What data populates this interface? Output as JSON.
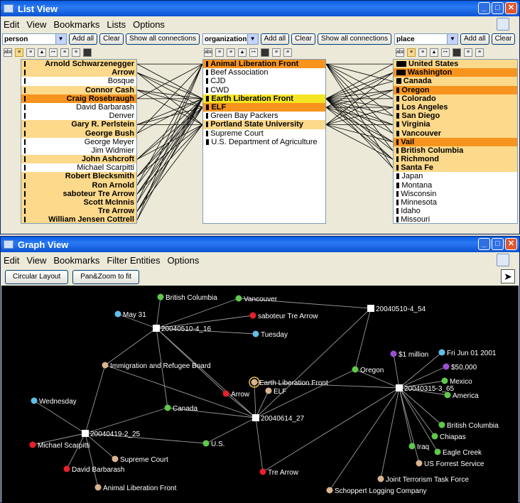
{
  "list_view": {
    "title": "List View",
    "menu": [
      "Edit",
      "View",
      "Bookmarks",
      "Lists",
      "Options"
    ],
    "columns": {
      "person": {
        "selector": "person",
        "add_all": "Add all",
        "clear": "Clear",
        "show_all": "Show all connections",
        "items": [
          {
            "label": "Arnold Schwarzenegger",
            "hl": "light"
          },
          {
            "label": "Arrow",
            "hl": "light"
          },
          {
            "label": "Bosque",
            "hl": "none"
          },
          {
            "label": "Connor Cash",
            "hl": "light"
          },
          {
            "label": "Craig Rosebraugh",
            "hl": "dark"
          },
          {
            "label": "David Barbarash",
            "hl": "none"
          },
          {
            "label": "Denver",
            "hl": "none"
          },
          {
            "label": "Gary R. Perlstein",
            "hl": "light"
          },
          {
            "label": "George Bush",
            "hl": "light"
          },
          {
            "label": "George Meyer",
            "hl": "none"
          },
          {
            "label": "Jim Widmier",
            "hl": "none"
          },
          {
            "label": "John Ashcroft",
            "hl": "light"
          },
          {
            "label": "Michael Scarpitti",
            "hl": "none"
          },
          {
            "label": "Robert Blecksmith",
            "hl": "light"
          },
          {
            "label": "Ron Arnold",
            "hl": "light"
          },
          {
            "label": "saboteur Tre Arrow",
            "hl": "light"
          },
          {
            "label": "Scott McInnis",
            "hl": "light"
          },
          {
            "label": "Tre Arrow",
            "hl": "light"
          },
          {
            "label": "William Jensen Cottrell",
            "hl": "light"
          }
        ]
      },
      "organization": {
        "selector": "organization",
        "add_all": "Add all",
        "clear": "Clear",
        "show_all": "Show all connections",
        "items": [
          {
            "label": "Animal Liberation Front",
            "hl": "dark",
            "weight": 1
          },
          {
            "label": "Beef Association",
            "hl": "none",
            "weight": 1
          },
          {
            "label": "CJD",
            "hl": "none",
            "weight": 1
          },
          {
            "label": "CWD",
            "hl": "none",
            "weight": 1
          },
          {
            "label": "Earth Liberation Front",
            "hl": "yellow",
            "weight": 2
          },
          {
            "label": "ELF",
            "hl": "dark",
            "weight": 2
          },
          {
            "label": "Green Bay Packers",
            "hl": "none",
            "weight": 1
          },
          {
            "label": "Portland State University",
            "hl": "light",
            "weight": 1
          },
          {
            "label": "Supreme Court",
            "hl": "none",
            "weight": 1
          },
          {
            "label": "U.S. Department of Agriculture",
            "hl": "none",
            "weight": 2
          }
        ]
      },
      "place": {
        "selector": "place",
        "add_all": "Add all",
        "clear": "Clear",
        "items": [
          {
            "label": "United States",
            "hl": "light",
            "weight": 10
          },
          {
            "label": "Washington",
            "hl": "dark",
            "weight": 9
          },
          {
            "label": "Canada",
            "hl": "light",
            "weight": 4
          },
          {
            "label": "Oregon",
            "hl": "dark",
            "weight": 2
          },
          {
            "label": "Colorado",
            "hl": "light",
            "weight": 2
          },
          {
            "label": "Los Angeles",
            "hl": "light",
            "weight": 2
          },
          {
            "label": "San Diego",
            "hl": "light",
            "weight": 2
          },
          {
            "label": "Virginia",
            "hl": "light",
            "weight": 2
          },
          {
            "label": "Vancouver",
            "hl": "light",
            "weight": 2
          },
          {
            "label": "Vail",
            "hl": "dark",
            "weight": 1
          },
          {
            "label": "British Columbia",
            "hl": "light",
            "weight": 1
          },
          {
            "label": "Richmond",
            "hl": "light",
            "weight": 1
          },
          {
            "label": "Santa Fe",
            "hl": "light",
            "weight": 1
          },
          {
            "label": "Japan",
            "hl": "none",
            "weight": 2
          },
          {
            "label": "Montana",
            "hl": "none",
            "weight": 2
          },
          {
            "label": "Wisconsin",
            "hl": "none",
            "weight": 1
          },
          {
            "label": "Minnesota",
            "hl": "none",
            "weight": 1
          },
          {
            "label": "Idaho",
            "hl": "none",
            "weight": 1
          },
          {
            "label": "Missouri",
            "hl": "none",
            "weight": 1
          }
        ]
      }
    }
  },
  "graph_view": {
    "title": "Graph View",
    "menu": [
      "Edit",
      "View",
      "Bookmarks",
      "Filter Entities",
      "Options"
    ],
    "buttons": {
      "circular": "Circular Layout",
      "panzoom": "Pan&Zoom to fit"
    },
    "colors": {
      "person": "#e8202a",
      "place": "#5fc94a",
      "organization": "#d9b48f",
      "date": "#5fbfe6",
      "money": "#9b4fd0",
      "document": "#ffffff"
    },
    "nodes": {
      "doc1": {
        "label": "20040510-4_16",
        "type": "document"
      },
      "doc2": {
        "label": "20040510-4_54",
        "type": "document"
      },
      "doc3": {
        "label": "20040419-2_25",
        "type": "document"
      },
      "doc4": {
        "label": "20040614_27",
        "type": "document"
      },
      "doc5": {
        "label": "20040315-3_65",
        "type": "document"
      },
      "bc1": {
        "label": "British Columbia",
        "type": "place"
      },
      "van": {
        "label": "Vancouver",
        "type": "place"
      },
      "may31": {
        "label": "May 31",
        "type": "date"
      },
      "sab": {
        "label": "saboteur Tre Arrow",
        "type": "person"
      },
      "tue": {
        "label": "Tuesday",
        "type": "date"
      },
      "irb": {
        "label": "Immigration and Refugee Board",
        "type": "organization"
      },
      "elfr": {
        "label": "Earth Liberation Front",
        "type": "organization"
      },
      "arrow": {
        "label": "Arrow",
        "type": "person"
      },
      "elf": {
        "label": "ELF",
        "type": "organization"
      },
      "oregon": {
        "label": "Oregon",
        "type": "place"
      },
      "million": {
        "label": "$1 million",
        "type": "money"
      },
      "fri": {
        "label": "Fri Jun 01 2001",
        "type": "date"
      },
      "k50": {
        "label": "$50,000",
        "type": "money"
      },
      "mexico": {
        "label": "Mexico",
        "type": "place"
      },
      "america": {
        "label": "America",
        "type": "place"
      },
      "wed": {
        "label": "Wednesday",
        "type": "date"
      },
      "canada": {
        "label": "Canada",
        "type": "place"
      },
      "bc2": {
        "label": "British Columbia",
        "type": "place"
      },
      "chiapas": {
        "label": "Chiapas",
        "type": "place"
      },
      "mike": {
        "label": "Michael Scarpitti",
        "type": "person"
      },
      "us": {
        "label": "U.S.",
        "type": "place"
      },
      "iraq": {
        "label": "Iraq",
        "type": "place"
      },
      "eagle": {
        "label": "Eagle Creek",
        "type": "place"
      },
      "sc": {
        "label": "Supreme Court",
        "type": "organization"
      },
      "usfs": {
        "label": "US Forrest Service",
        "type": "organization"
      },
      "dave": {
        "label": "David Barbarash",
        "type": "person"
      },
      "tre": {
        "label": "Tre Arrow",
        "type": "person"
      },
      "jttf": {
        "label": "Joint Terrorism Task Force",
        "type": "organization"
      },
      "alf": {
        "label": "Animal Liberation Front",
        "type": "organization"
      },
      "slc": {
        "label": "Schoppert Logging Company",
        "type": "organization"
      }
    }
  }
}
